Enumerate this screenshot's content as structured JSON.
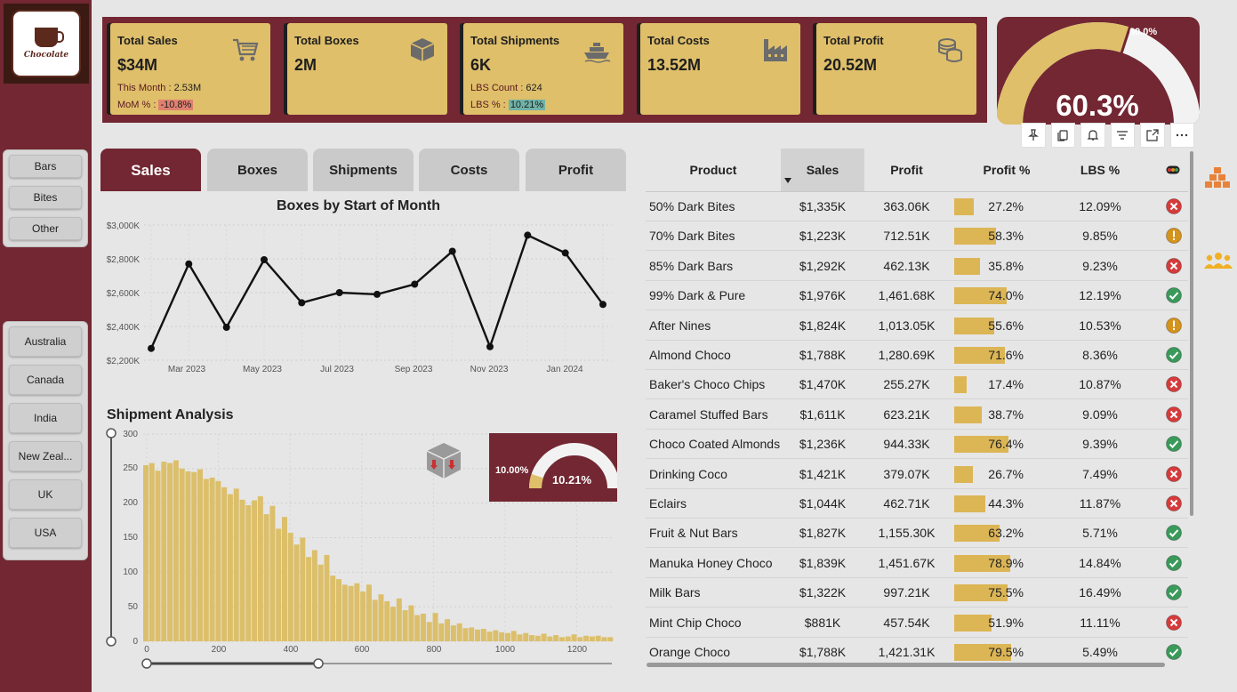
{
  "logo": {
    "text": "Chocolate"
  },
  "slicers": {
    "category": [
      "Bars",
      "Bites",
      "Other"
    ],
    "country": [
      "Australia",
      "Canada",
      "India",
      "New Zeal...",
      "UK",
      "USA"
    ]
  },
  "kpis": [
    {
      "title": "Total Sales",
      "value": "$34M",
      "sub1_label": "This Month :",
      "sub1_value": "2.53M",
      "sub2_label": "MoM % :",
      "sub2_value": "-10.8%",
      "icon": "cart-icon"
    },
    {
      "title": "Total Boxes",
      "value": "2M",
      "icon": "box-icon"
    },
    {
      "title": "Total Shipments",
      "value": "6K",
      "sub1_label": "LBS Count :",
      "sub1_value": "624",
      "sub2_label": "LBS % :",
      "sub2_value": "10.21%",
      "icon": "ship-icon"
    },
    {
      "title": "Total Costs",
      "value": "13.52M",
      "icon": "factory-icon"
    },
    {
      "title": "Total Profit",
      "value": "20.52M",
      "icon": "coins-icon"
    }
  ],
  "top_gauge": {
    "value_label": "60.3%",
    "target_label": "60.0%",
    "value": 0.603,
    "target": 0.6
  },
  "tabs": [
    "Sales",
    "Boxes",
    "Shipments",
    "Costs",
    "Profit"
  ],
  "active_tab": 0,
  "line_chart": {
    "title": "Boxes by Start of Month",
    "y_ticks": [
      "$3,000K",
      "$2,800K",
      "$2,600K",
      "$2,400K",
      "$2,200K"
    ],
    "x_ticks": [
      "Mar 2023",
      "May 2023",
      "Jul 2023",
      "Sep 2023",
      "Nov 2023",
      "Jan 2024"
    ]
  },
  "histogram": {
    "title": "Shipment Analysis",
    "y_ticks": [
      "300",
      "250",
      "200",
      "150",
      "100",
      "50",
      "0"
    ],
    "x_ticks": [
      "0",
      "200",
      "400",
      "600",
      "800",
      "1000",
      "1200"
    ]
  },
  "mini_gauge": {
    "target_label": "10.00%",
    "value_label": "10.21%",
    "value": 0.1021,
    "target": 0.1
  },
  "table": {
    "headers": [
      "Product",
      "Sales",
      "Profit",
      "Profit %",
      "LBS %"
    ],
    "rows": [
      {
        "product": "50% Dark Bites",
        "sales": "$1,335K",
        "profit": "363.06K",
        "profit_pct": "27.2%",
        "pct": 27.2,
        "lbs": "12.09%",
        "status": "bad"
      },
      {
        "product": "70% Dark Bites",
        "sales": "$1,223K",
        "profit": "712.51K",
        "profit_pct": "58.3%",
        "pct": 58.3,
        "lbs": "9.85%",
        "status": "warn"
      },
      {
        "product": "85% Dark Bars",
        "sales": "$1,292K",
        "profit": "462.13K",
        "profit_pct": "35.8%",
        "pct": 35.8,
        "lbs": "9.23%",
        "status": "bad"
      },
      {
        "product": "99% Dark & Pure",
        "sales": "$1,976K",
        "profit": "1,461.68K",
        "profit_pct": "74.0%",
        "pct": 74.0,
        "lbs": "12.19%",
        "status": "good"
      },
      {
        "product": "After Nines",
        "sales": "$1,824K",
        "profit": "1,013.05K",
        "profit_pct": "55.6%",
        "pct": 55.6,
        "lbs": "10.53%",
        "status": "warn"
      },
      {
        "product": "Almond Choco",
        "sales": "$1,788K",
        "profit": "1,280.69K",
        "profit_pct": "71.6%",
        "pct": 71.6,
        "lbs": "8.36%",
        "status": "good"
      },
      {
        "product": "Baker's Choco Chips",
        "sales": "$1,470K",
        "profit": "255.27K",
        "profit_pct": "17.4%",
        "pct": 17.4,
        "lbs": "10.87%",
        "status": "bad"
      },
      {
        "product": "Caramel Stuffed Bars",
        "sales": "$1,611K",
        "profit": "623.21K",
        "profit_pct": "38.7%",
        "pct": 38.7,
        "lbs": "9.09%",
        "status": "bad"
      },
      {
        "product": "Choco Coated Almonds",
        "sales": "$1,236K",
        "profit": "944.33K",
        "profit_pct": "76.4%",
        "pct": 76.4,
        "lbs": "9.39%",
        "status": "good"
      },
      {
        "product": "Drinking Coco",
        "sales": "$1,421K",
        "profit": "379.07K",
        "profit_pct": "26.7%",
        "pct": 26.7,
        "lbs": "7.49%",
        "status": "bad"
      },
      {
        "product": "Eclairs",
        "sales": "$1,044K",
        "profit": "462.71K",
        "profit_pct": "44.3%",
        "pct": 44.3,
        "lbs": "11.87%",
        "status": "bad"
      },
      {
        "product": "Fruit & Nut Bars",
        "sales": "$1,827K",
        "profit": "1,155.30K",
        "profit_pct": "63.2%",
        "pct": 63.2,
        "lbs": "5.71%",
        "status": "good"
      },
      {
        "product": "Manuka Honey Choco",
        "sales": "$1,839K",
        "profit": "1,451.67K",
        "profit_pct": "78.9%",
        "pct": 78.9,
        "lbs": "14.84%",
        "status": "good"
      },
      {
        "product": "Milk Bars",
        "sales": "$1,322K",
        "profit": "997.21K",
        "profit_pct": "75.5%",
        "pct": 75.5,
        "lbs": "16.49%",
        "status": "good"
      },
      {
        "product": "Mint Chip Choco",
        "sales": "$881K",
        "profit": "457.54K",
        "profit_pct": "51.9%",
        "pct": 51.9,
        "lbs": "11.11%",
        "status": "bad"
      },
      {
        "product": "Orange Choco",
        "sales": "$1,788K",
        "profit": "1,421.31K",
        "profit_pct": "79.5%",
        "pct": 79.5,
        "lbs": "5.49%",
        "status": "good"
      }
    ]
  },
  "colors": {
    "maroon": "#722732",
    "gold": "#dfbf6a",
    "bar_gold": "#dcb555",
    "good": "#3a9a5a",
    "bad": "#d63b3b",
    "warn": "#d4931c"
  },
  "chart_data": [
    {
      "type": "line",
      "title": "Boxes by Start of Month",
      "x": [
        "Feb 2023",
        "Mar 2023",
        "Apr 2023",
        "May 2023",
        "Jun 2023",
        "Jul 2023",
        "Aug 2023",
        "Sep 2023",
        "Oct 2023",
        "Nov 2023",
        "Dec 2023",
        "Jan 2024",
        "Feb 2024"
      ],
      "values": [
        2270,
        2770,
        2395,
        2795,
        2540,
        2600,
        2590,
        2650,
        2845,
        2280,
        2940,
        2835,
        2530
      ],
      "ylim": [
        2200,
        3000
      ],
      "y_unit": "K",
      "grid": true
    },
    {
      "type": "bar",
      "title": "Shipment Analysis",
      "x_range": [
        0,
        1300
      ],
      "ylim": [
        0,
        300
      ],
      "values": [
        255,
        258,
        247,
        260,
        258,
        262,
        250,
        246,
        245,
        249,
        235,
        237,
        232,
        223,
        213,
        221,
        205,
        197,
        204,
        210,
        184,
        196,
        163,
        180,
        157,
        140,
        150,
        122,
        132,
        111,
        125,
        95,
        90,
        82,
        80,
        84,
        72,
        82,
        60,
        68,
        58,
        50,
        62,
        45,
        52,
        38,
        40,
        28,
        41,
        26,
        32,
        23,
        26,
        19,
        20,
        17,
        18,
        14,
        16,
        13,
        12,
        15,
        10,
        12,
        9,
        8,
        11,
        7,
        9,
        6,
        7,
        10,
        6,
        8,
        7,
        8,
        6,
        6
      ]
    }
  ]
}
